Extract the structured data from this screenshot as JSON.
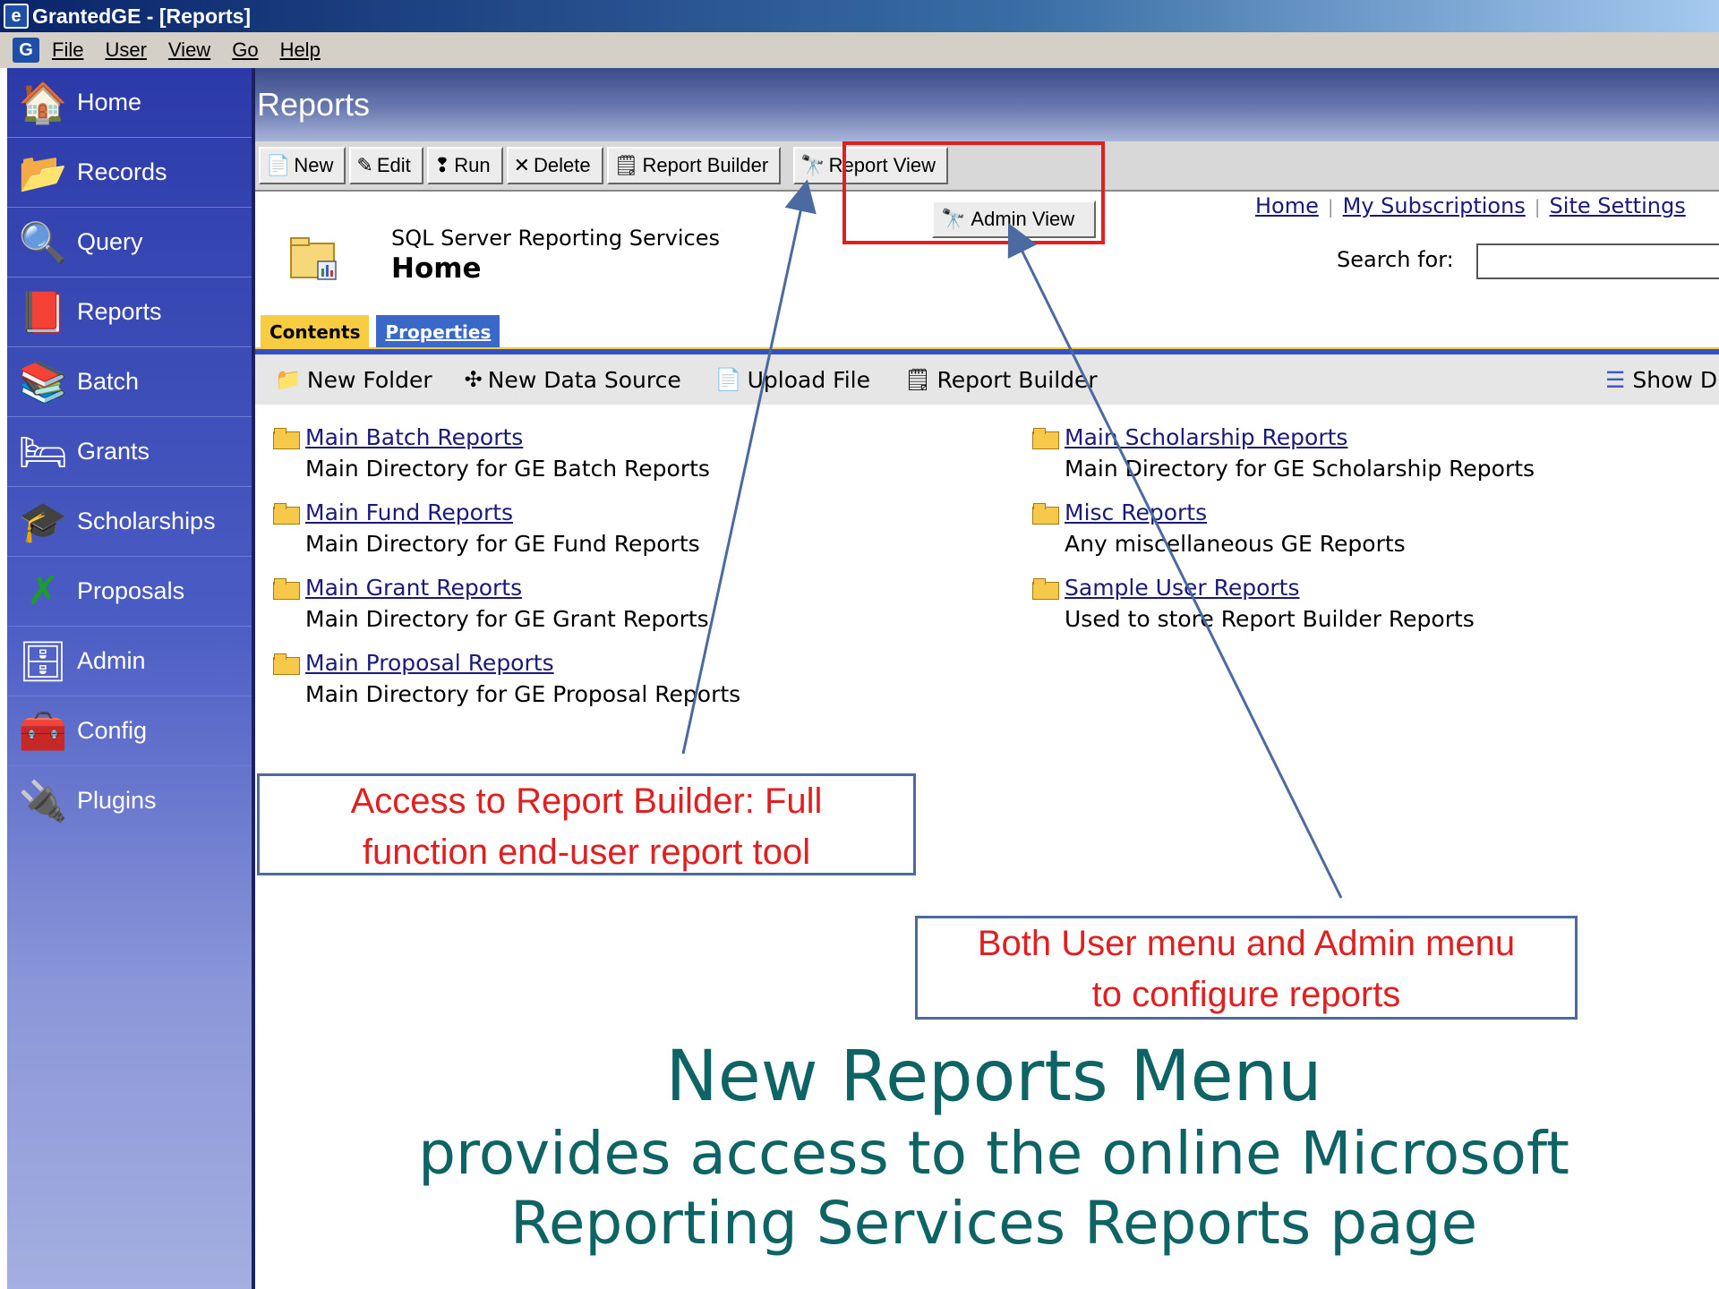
{
  "window": {
    "title": "GrantedGE - [Reports]",
    "icon": "granted-logo-icon"
  },
  "menubar": {
    "items": [
      "File",
      "User",
      "View",
      "Go",
      "Help"
    ]
  },
  "sidebar": {
    "items": [
      {
        "label": "Home",
        "icon": "house-icon"
      },
      {
        "label": "Records",
        "icon": "folders-icon"
      },
      {
        "label": "Query",
        "icon": "magnifier-icon"
      },
      {
        "label": "Reports",
        "icon": "report-book-icon"
      },
      {
        "label": "Batch",
        "icon": "stack-icon"
      },
      {
        "label": "Grants",
        "icon": "grants-icon"
      },
      {
        "label": "Scholarships",
        "icon": "graduation-cap-icon"
      },
      {
        "label": "Proposals",
        "icon": "proposal-icon"
      },
      {
        "label": "Admin",
        "icon": "cabinet-icon"
      },
      {
        "label": "Config",
        "icon": "toolbox-icon"
      },
      {
        "label": "Plugins",
        "icon": "plug-icon"
      }
    ]
  },
  "header": {
    "title": "Reports"
  },
  "toolbar": {
    "buttons": [
      {
        "label": "New",
        "icon": "new-page-icon"
      },
      {
        "label": "Edit",
        "icon": "edit-icon"
      },
      {
        "label": "Run",
        "icon": "run-icon"
      },
      {
        "label": "Delete",
        "icon": "delete-x-icon"
      },
      {
        "label": "Report Builder",
        "icon": "report-builder-icon"
      },
      {
        "label": "Report View",
        "icon": "binoculars-icon"
      }
    ],
    "admin_view": "Admin View"
  },
  "ssrs": {
    "subtitle": "SQL Server Reporting Services",
    "title": "Home",
    "links": [
      "Home",
      "My Subscriptions",
      "Site Settings"
    ],
    "search_label": "Search for:",
    "search_value": "",
    "tabs": [
      "Contents",
      "Properties"
    ],
    "actions": [
      "New Folder",
      "New Data Source",
      "Upload File",
      "Report Builder",
      "Show D"
    ],
    "folders_left": [
      {
        "name": "Main Batch Reports",
        "desc": "Main Directory for GE Batch Reports"
      },
      {
        "name": "Main Fund Reports",
        "desc": "Main Directory for GE Fund Reports"
      },
      {
        "name": "Main Grant Reports",
        "desc": "Main Directory for GE Grant Reports"
      },
      {
        "name": "Main Proposal Reports",
        "desc": "Main Directory for GE Proposal Reports"
      }
    ],
    "folders_right": [
      {
        "name": "Main Scholarship Reports",
        "desc": "Main Directory for GE Scholarship Reports"
      },
      {
        "name": "Misc Reports",
        "desc": "Any miscellaneous GE Reports"
      },
      {
        "name": "Sample User Reports",
        "desc": "Used to store Report Builder Reports"
      }
    ]
  },
  "annotations": {
    "callout1_line1": "Access to Report Builder: Full",
    "callout1_line2": "function end-user report tool",
    "callout2_line1": "Both User menu and Admin menu",
    "callout2_line2": "to configure reports",
    "heading": "New Reports Menu",
    "sub1": "provides access to the online Microsoft",
    "sub2": "Reporting Services Reports page",
    "colors": {
      "callout_text": "#e02020",
      "heading": "#0e6464",
      "highlight_box": "#e02020"
    }
  }
}
